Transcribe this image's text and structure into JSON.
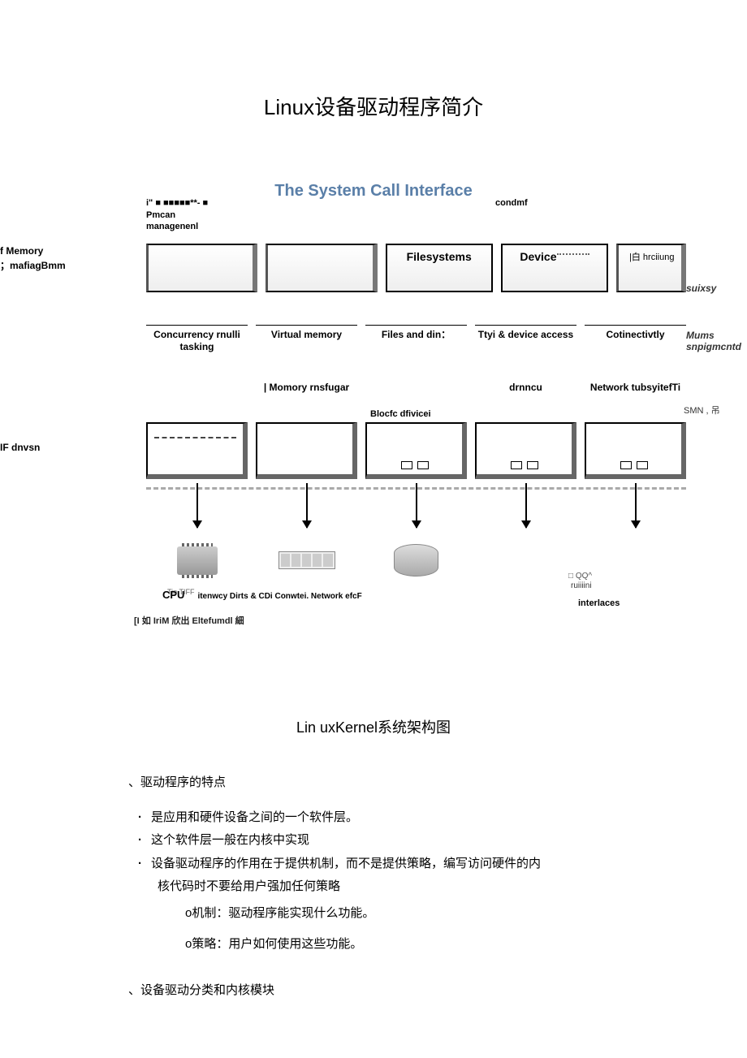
{
  "title": "Linux设备驱动程序简介",
  "diagram": {
    "sci_title": "The System Call Interface",
    "top1": "i\" ■ ■■■■■**- ■",
    "top2": "Pmcan",
    "top3": "managenenl",
    "top4": "condmf",
    "left1": "f Memory",
    "left2": "；mafiagBmm",
    "left3": "IF dnvsn",
    "right1": "suixsy",
    "right2": "Mums",
    "right3": "snpigmcntd",
    "right4": "SMN ,\n吊",
    "box_filesystems": "Filesystems",
    "box_device": "Device",
    "hr_label": "|白 hrciiung",
    "row_labels": [
      "Concurrency rnulli tasking",
      "Virtual memory",
      "Files and din：",
      "Ttyi & device access",
      "Cotinectivtly"
    ],
    "row_labels_2": [
      "",
      "| Momory rnsfugar",
      "",
      "drnncu",
      "Network tubsyitefTi"
    ],
    "dev_label_3": "Blocfc dfivicei",
    "tin": "Tin     TIFF",
    "cpu": "CPU",
    "bottom_line": "itenwcy Dirts & CDi Conwtei. Network efcF",
    "bottom_right": "interlaces",
    "qq": "□ QQ^",
    "ru": "ruiiiini",
    "footer": "[I 如 IriM 欣出 Eltefumdl 細"
  },
  "caption": "Lin uxKernel系统架构图",
  "section1_title": "、驱动程序的特点",
  "bullets": [
    "是应用和硬件设备之间的一个软件层。",
    "这个软件层一般在内核中实现",
    "设备驱动程序的作用在于提供机制，而不是提供策略，编写访问硬件的内"
  ],
  "bullet3_cont": "核代码时不要给用户强加任何策略",
  "sub_o1": "o机制：驱动程序能实现什么功能。",
  "sub_o2": "o策略：用户如何使用这些功能。",
  "section2_title": "、设备驱动分类和内核模块"
}
